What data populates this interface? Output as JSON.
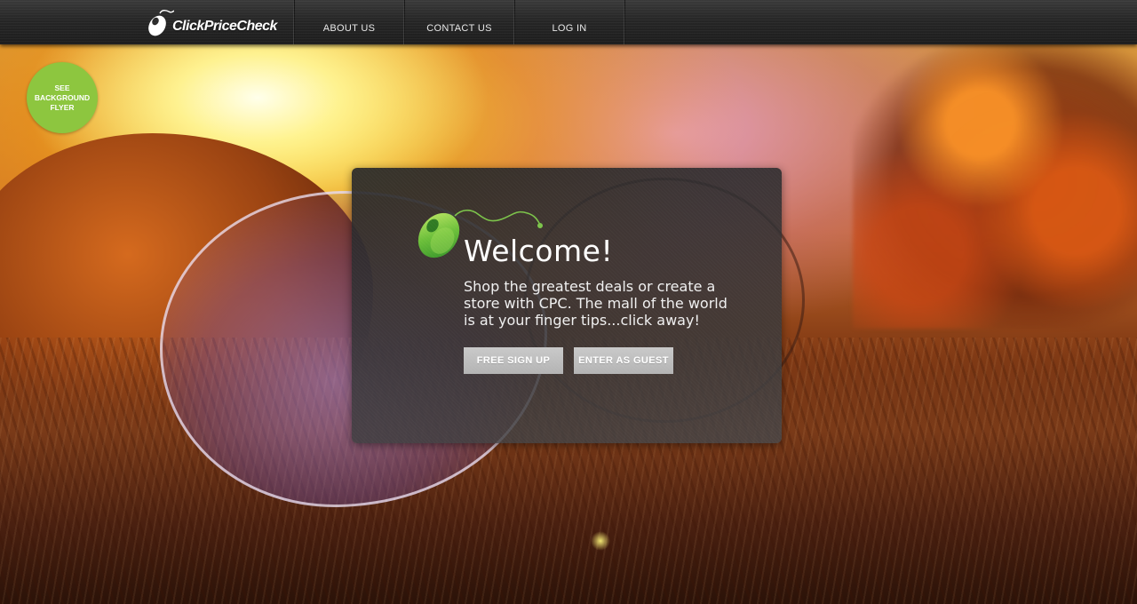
{
  "brand": {
    "name": "ClickPriceCheck",
    "accent": "#8dc63f"
  },
  "nav": {
    "items": [
      {
        "label": "ABOUT US"
      },
      {
        "label": "CONTACT US"
      },
      {
        "label": "LOG IN"
      }
    ]
  },
  "flyer": {
    "label": "SEE BACKGROUND FLYER"
  },
  "welcome": {
    "title": "Welcome!",
    "body": "Shop the greatest deals or create a store with CPC. The mall of the world is at your finger tips...click away!",
    "buttons": {
      "signup": "FREE SIGN UP",
      "guest": "ENTER AS GUEST"
    }
  },
  "icons": {
    "logo": "mouse-logo-icon",
    "panel": "green-mouse-icon"
  }
}
